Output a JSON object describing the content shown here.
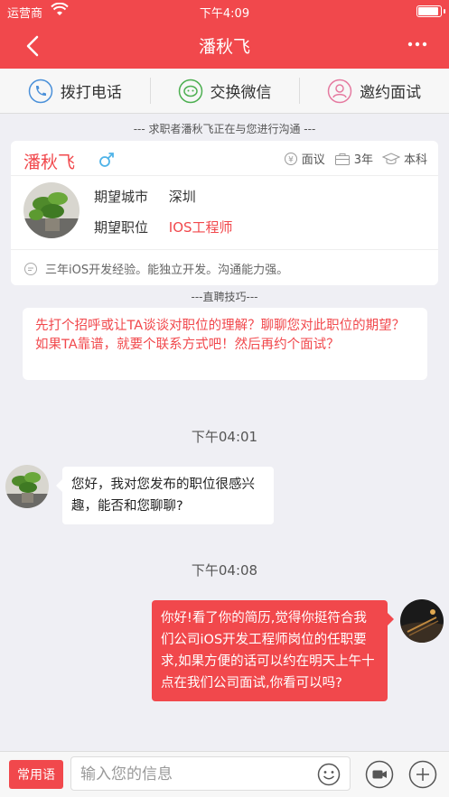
{
  "status": {
    "carrier": "运营商",
    "time": "下午4:09"
  },
  "nav": {
    "title": "潘秋飞"
  },
  "actions": [
    {
      "label": "拨打电话"
    },
    {
      "label": "交换微信"
    },
    {
      "label": "邀约面试"
    }
  ],
  "notice": "--- 求职者潘秋飞正在与您进行沟通 ---",
  "candidate": {
    "name": "潘秋飞",
    "salary": "面议",
    "experience": "3年",
    "education": "本科",
    "city_label": "期望城市",
    "city": "深圳",
    "position_label": "期望职位",
    "position": "IOS工程师",
    "summary": "三年iOS开发经验。能独立开发。沟通能力强。"
  },
  "tips": {
    "heading": "---直聘技巧---",
    "text": "先打个招呼或让TA谈谈对职位的理解？聊聊您对此职位的期望？如果TA靠谱，就要个联系方式吧！然后再约个面试？"
  },
  "messages": [
    {
      "time": "下午04:01",
      "side": "left",
      "text": "您好，我对您发布的职位很感兴趣，能否和您聊聊?"
    },
    {
      "time": "下午04:08",
      "side": "right",
      "text": "你好!看了你的简历,觉得你挺符合我们公司iOS开发工程师岗位的任职要求,如果方便的话可以约在明天上午十点在我们公司面试,你看可以吗?"
    }
  ],
  "input": {
    "phrases_label": "常用语",
    "placeholder": "输入您的信息"
  },
  "colors": {
    "accent": "#f1484c",
    "background": "#efeff4"
  },
  "icons": [
    "wifi-icon",
    "battery-icon",
    "back-arrow-icon",
    "more-icon",
    "phone-icon",
    "wechat-icon",
    "user-icon",
    "male-icon",
    "salary-icon",
    "briefcase-icon",
    "graduation-cap-icon",
    "chat-bubble-icon",
    "emoji-icon",
    "video-icon",
    "plus-icon"
  ]
}
